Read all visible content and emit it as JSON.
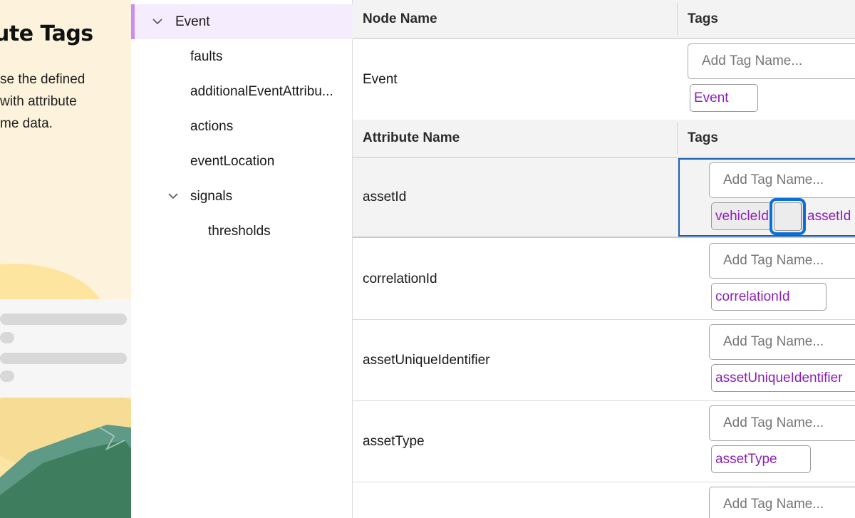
{
  "info": {
    "title": "ute Tags",
    "lines": [
      "se the defined",
      "with attribute",
      "me data."
    ]
  },
  "tree": {
    "items": [
      {
        "label": "Event",
        "expanded": true,
        "selected": true
      },
      {
        "label": "faults"
      },
      {
        "label": "additionalEventAttribu..."
      },
      {
        "label": "actions"
      },
      {
        "label": "eventLocation"
      },
      {
        "label": "signals",
        "expanded": true
      },
      {
        "label": "thresholds"
      }
    ]
  },
  "table": {
    "node_header": {
      "name_col": "Node Name",
      "tags_col": "Tags"
    },
    "node_row": {
      "name": "Event",
      "placeholder": "Add Tag Name...",
      "tags": [
        "Event"
      ]
    },
    "attr_header": {
      "name_col": "Attribute Name",
      "tags_col": "Tags"
    },
    "rows": [
      {
        "name": "assetId",
        "placeholder": "Add Tag Name...",
        "tags": [
          "vehicleId",
          "",
          "assetId"
        ]
      },
      {
        "name": "correlationId",
        "placeholder": "Add Tag Name...",
        "tags": [
          "correlationId"
        ]
      },
      {
        "name": "assetUniqueIdentifier",
        "placeholder": "Add Tag Name...",
        "tags": [
          "assetUniqueIdentifier"
        ]
      },
      {
        "name": "assetType",
        "placeholder": "Add Tag Name...",
        "tags": [
          "assetType"
        ]
      },
      {
        "name": "",
        "placeholder": "Add Tag Name...",
        "tags": []
      }
    ]
  },
  "colors": {
    "tag_text": "#8a1fb8",
    "selection_accent": "#c88ef2",
    "focus": "#0b6fd6"
  }
}
